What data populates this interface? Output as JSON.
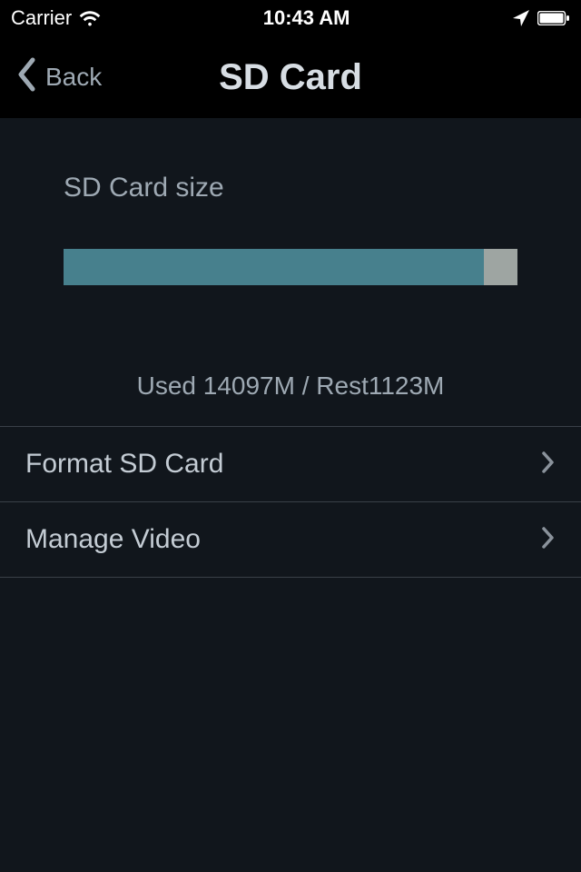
{
  "status": {
    "carrier": "Carrier",
    "time": "10:43 AM"
  },
  "nav": {
    "back_label": "Back",
    "title": "SD Card"
  },
  "sd": {
    "size_label": "SD Card size",
    "used_mb": 14097,
    "rest_mb": 1123,
    "usage_text": "Used 14097M / Rest1123M"
  },
  "menu": {
    "format_label": "Format SD Card",
    "manage_label": "Manage Video"
  }
}
